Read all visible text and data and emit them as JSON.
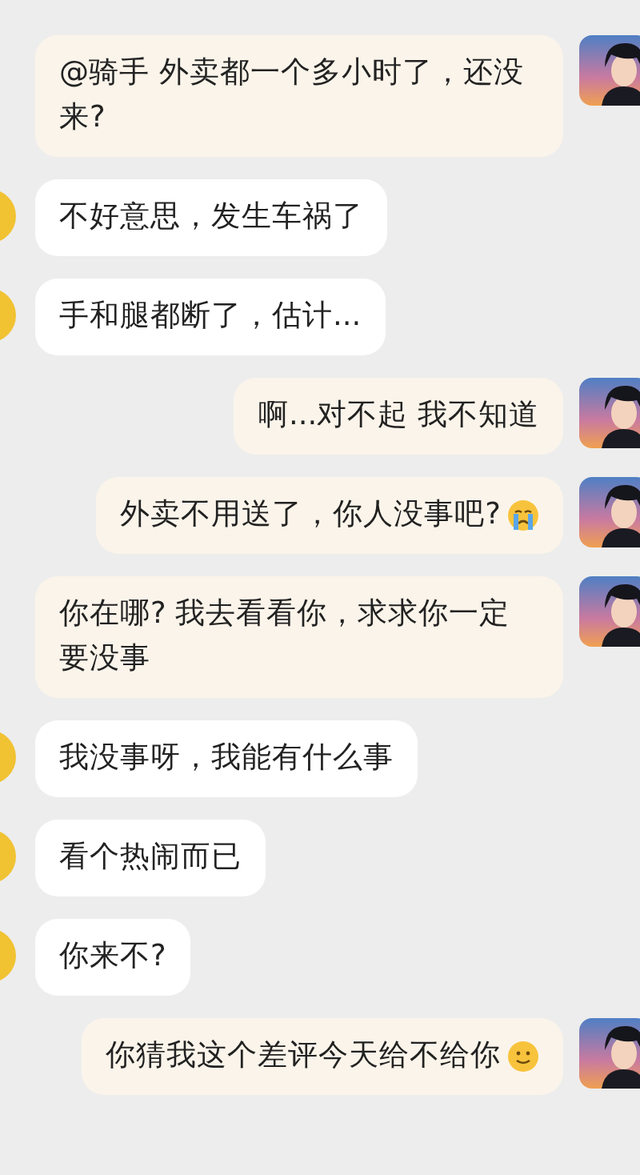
{
  "messages": [
    {
      "kind": "sent",
      "text": "@骑手 外卖都一个多小时了，还没来?"
    },
    {
      "kind": "received",
      "text": "不好意思，发生车祸了"
    },
    {
      "kind": "received",
      "text": "手和腿都断了，估计..."
    },
    {
      "kind": "sent",
      "text": "啊...对不起 我不知道"
    },
    {
      "kind": "sent",
      "text": "外卖不用送了，你人没事吧?",
      "icons": [
        {
          "kind": "crying"
        }
      ]
    },
    {
      "kind": "sent",
      "text": "你在哪? 我去看看你，求求你一定要没事"
    },
    {
      "kind": "received",
      "text": "我没事呀，我能有什么事"
    },
    {
      "kind": "received",
      "text": "看个热闹而已"
    },
    {
      "kind": "received",
      "text": "你来不?"
    },
    {
      "kind": "sent",
      "text": "你猜我这个差评今天给不给你",
      "icons": [
        {
          "kind": "smile"
        }
      ]
    }
  ]
}
